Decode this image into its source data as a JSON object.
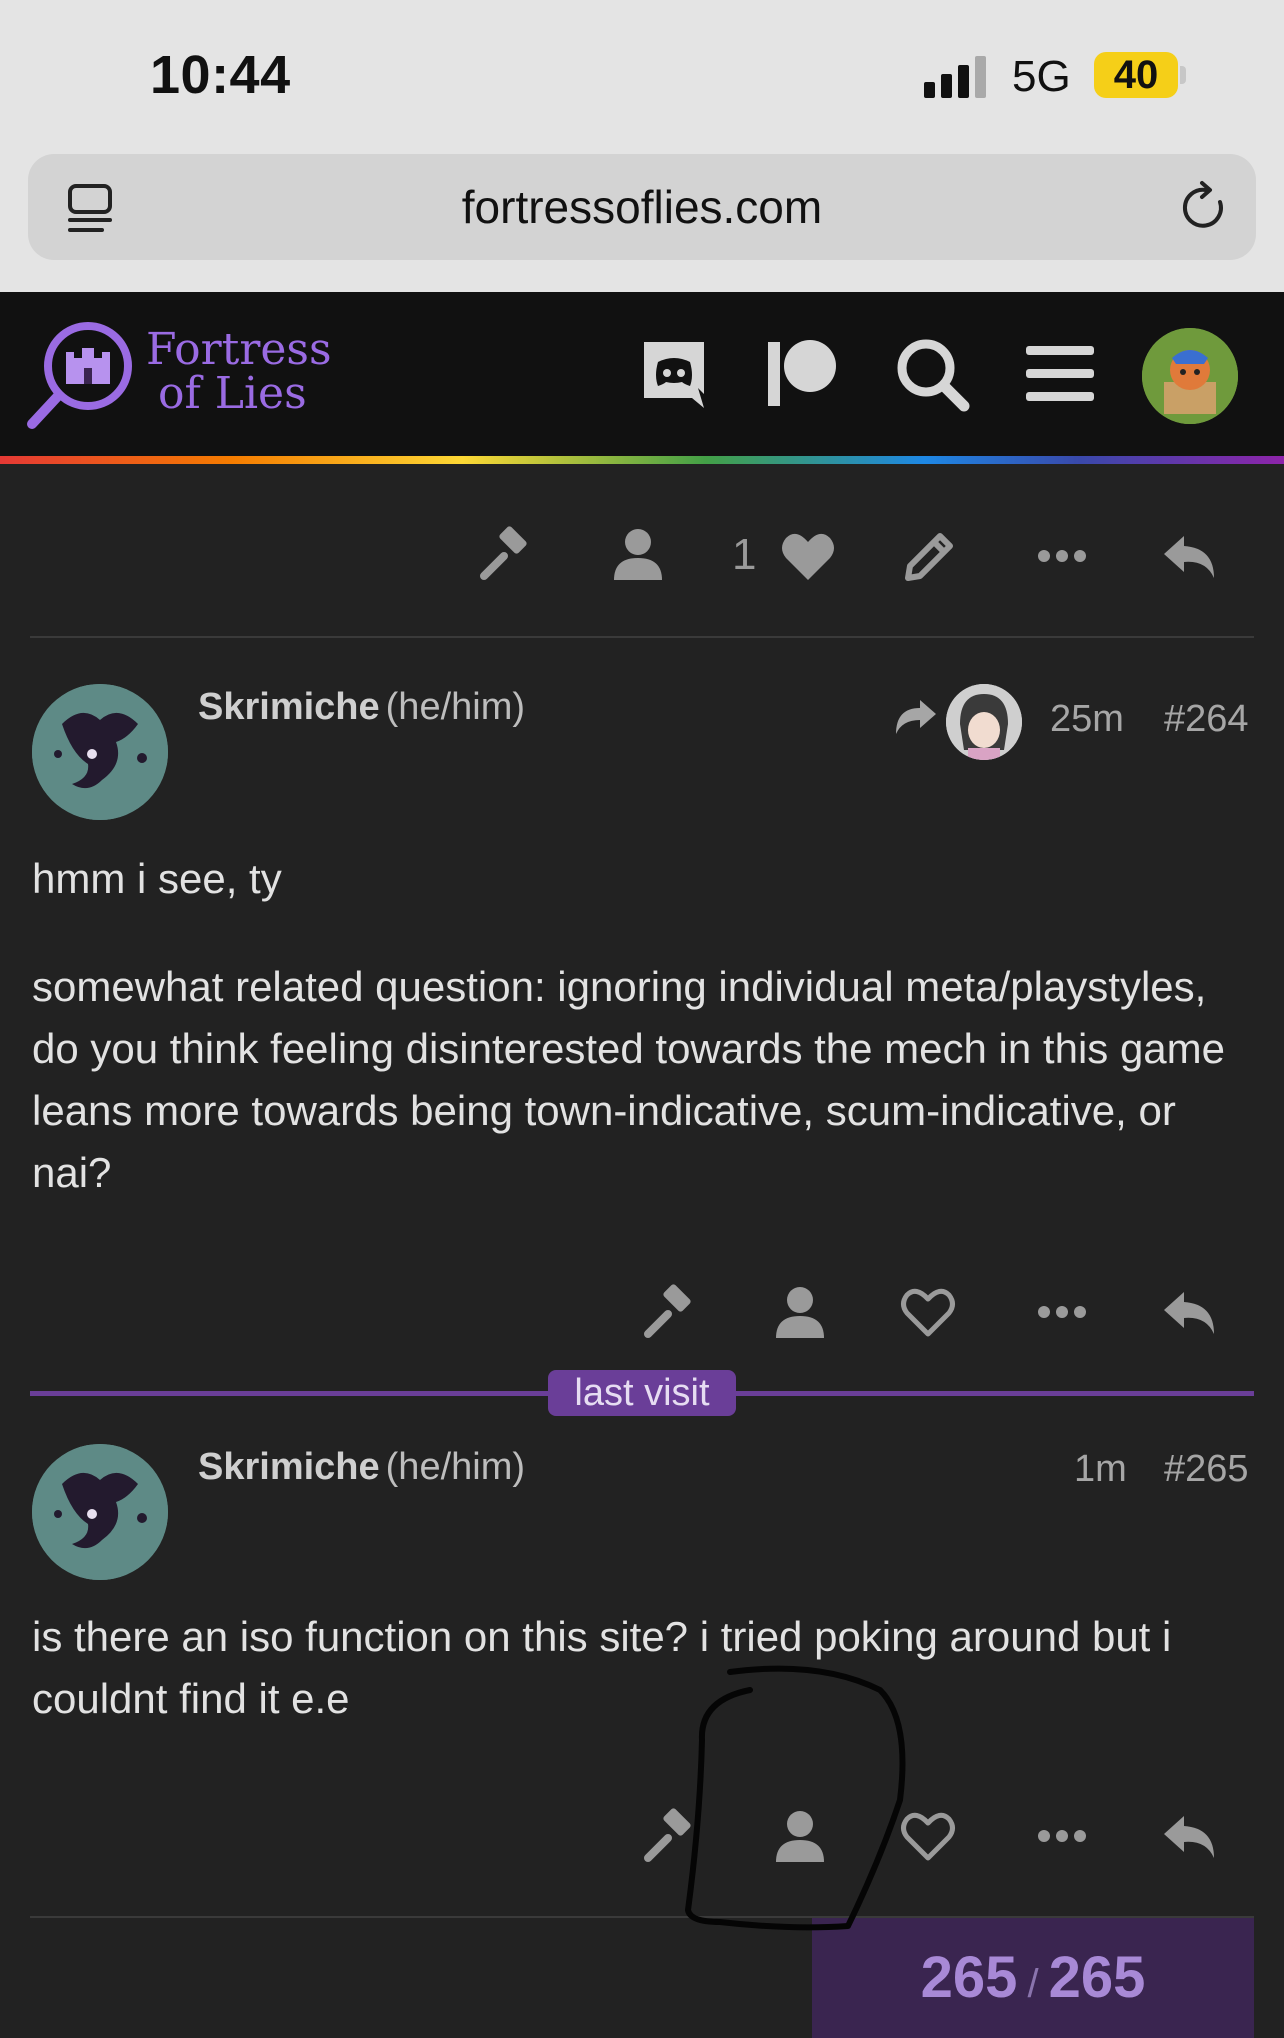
{
  "status_bar": {
    "time": "10:44",
    "network": "5G",
    "battery": "40"
  },
  "browser": {
    "url": "fortressoflies.com"
  },
  "site": {
    "logo_line1": "Fortress",
    "logo_line2": "of Lies"
  },
  "top_actions": {
    "like_count": "1"
  },
  "posts": [
    {
      "username": "Skrimiche",
      "pronouns": "(he/him)",
      "time": "25m",
      "number": "#264",
      "paragraphs": [
        "hmm i see, ty",
        "somewhat related question: ignoring individual meta/playstyles, do you think feeling disinterested towards the mech in this game leans more towards being town-indicative, scum-indicative, or nai?"
      ]
    },
    {
      "username": "Skrimiche",
      "pronouns": "(he/him)",
      "time": "1m",
      "number": "#265",
      "paragraphs": [
        "is there an iso function on this site? i tried poking around but i couldnt find it e.e"
      ]
    }
  ],
  "last_visit_label": "last visit",
  "progress": {
    "current": "265",
    "separator": "/",
    "total": "265"
  },
  "colors": {
    "accent": "#9a6be3",
    "background": "#222222",
    "header": "#111111",
    "last_visit": "#6a3e98"
  }
}
